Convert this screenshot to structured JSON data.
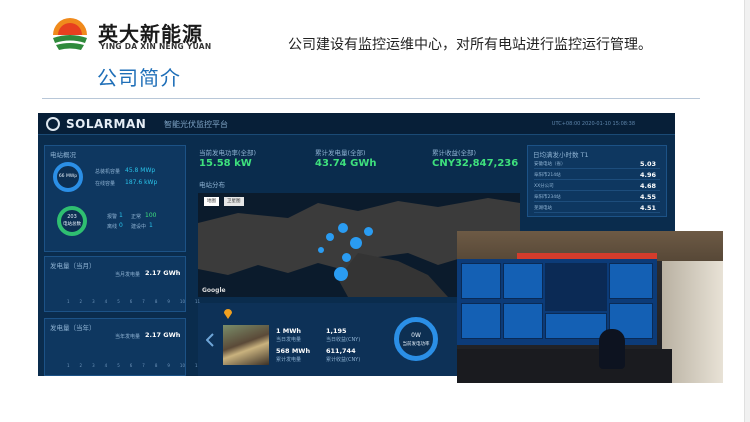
{
  "brand": {
    "name_cn": "英大新能源",
    "name_en": "YING DA XIN NENG YUAN"
  },
  "section": {
    "title": "公司简介",
    "intro": "公司建设有监控运维中心，对所有电站进行监控运行管理。"
  },
  "dashboard": {
    "app_name": "SOLARMAN",
    "app_subtitle": "智能光伏监控平台",
    "timestamp": "UTC+08:00 2020-01-10 15:08:38",
    "overview": {
      "title": "电站概况",
      "ring1_text": "66 MWp",
      "installed_label": "总装机容量",
      "installed_value": "45.8 MWp",
      "online_label": "在线容量",
      "online_value": "187.6 kWp",
      "ring2_value": "203",
      "ring2_label": "电站总数",
      "alarm_label": "报警",
      "alarm_value": "1",
      "normal_label": "正常",
      "normal_value": "100",
      "offline_label": "离线",
      "offline_value": "0",
      "building_label": "建设中",
      "building_value": "1"
    },
    "gen_month": {
      "title": "发电量（当月）",
      "label": "当月发电量",
      "value": "2.17 GWh",
      "ticks": [
        "1",
        "2",
        "3",
        "4",
        "5",
        "6",
        "7",
        "8",
        "9",
        "10",
        "11"
      ]
    },
    "gen_year": {
      "title": "发电量（当年）",
      "label": "当年发电量",
      "value": "2.17 GWh",
      "ticks": [
        "1",
        "2",
        "3",
        "4",
        "5",
        "6",
        "7",
        "8",
        "9",
        "10",
        "11"
      ]
    },
    "kpis": [
      {
        "title": "当前发电功率(全部)",
        "value": "15.58 kW"
      },
      {
        "title": "累计发电量(全部)",
        "value": "43.74 GWh"
      },
      {
        "title": "累计收益(全部)",
        "value": "CNY32,847,236"
      }
    ],
    "map": {
      "title": "电站分布",
      "tab_map": "地图",
      "tab_satellite": "卫星图",
      "attribution": "Google"
    },
    "ranking": {
      "title": "日均满发小时数  T1",
      "rows": [
        {
          "name": "安徽电站（省）",
          "value": "5.03"
        },
        {
          "name": "阜阳市214站",
          "value": "4.96"
        },
        {
          "name": "XX分公司",
          "value": "4.68"
        },
        {
          "name": "阜阳市234站",
          "value": "4.55"
        },
        {
          "name": "芜湖电站",
          "value": "4.51"
        }
      ]
    },
    "detail": {
      "stat1_value": "1 MWh",
      "stat1_label": "当日发电量",
      "stat2_value": "1,195",
      "stat2_label": "当日收益(CNY)",
      "stat3_value": "568 MWh",
      "stat3_label": "累计发电量",
      "stat4_value": "611,744",
      "stat4_label": "累计收益(CNY)",
      "gauge_label": "0W",
      "gauge_sub": "当前发电功率"
    }
  },
  "colors": {
    "title_blue": "#1f6fb8",
    "dash_bg": "#0a2c4d",
    "kpi_green": "#3ee07d",
    "cyan": "#29c3ea"
  }
}
